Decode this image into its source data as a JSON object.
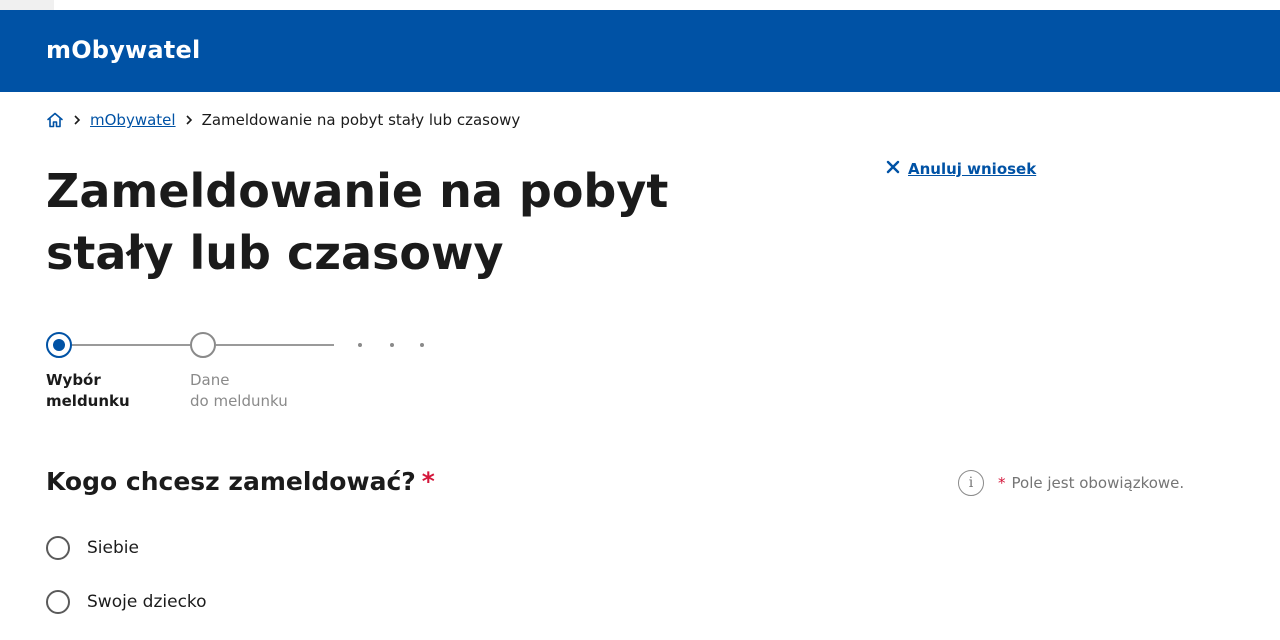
{
  "header": {
    "title": "mObywatel",
    "brand_color": "#0052a5"
  },
  "breadcrumb": {
    "home_icon": "home-icon",
    "items": [
      {
        "label": "mObywatel",
        "link": true
      },
      {
        "label": "Zameldowanie na pobyt stały lub czasowy",
        "link": false
      }
    ]
  },
  "cancel": {
    "icon": "close-icon",
    "label": "Anuluj wniosek"
  },
  "page": {
    "title": "Zameldowanie na pobyt stały lub czasowy"
  },
  "stepper": {
    "steps": [
      {
        "line1": "Wybór",
        "line2": "meldunku",
        "state": "active"
      },
      {
        "line1": "Dane",
        "line2": "do meldunku",
        "state": "upcoming"
      }
    ],
    "more_steps_indicator": "dots"
  },
  "question": {
    "text": "Kogo chcesz zameldować?",
    "required_mark": "*",
    "required_color": "#d4173b"
  },
  "required_note": {
    "icon": "info-icon",
    "star": "*",
    "text": "Pole jest obowiązkowe."
  },
  "options": [
    {
      "label": "Siebie",
      "selected": false
    },
    {
      "label": "Swoje dziecko",
      "selected": false
    }
  ]
}
